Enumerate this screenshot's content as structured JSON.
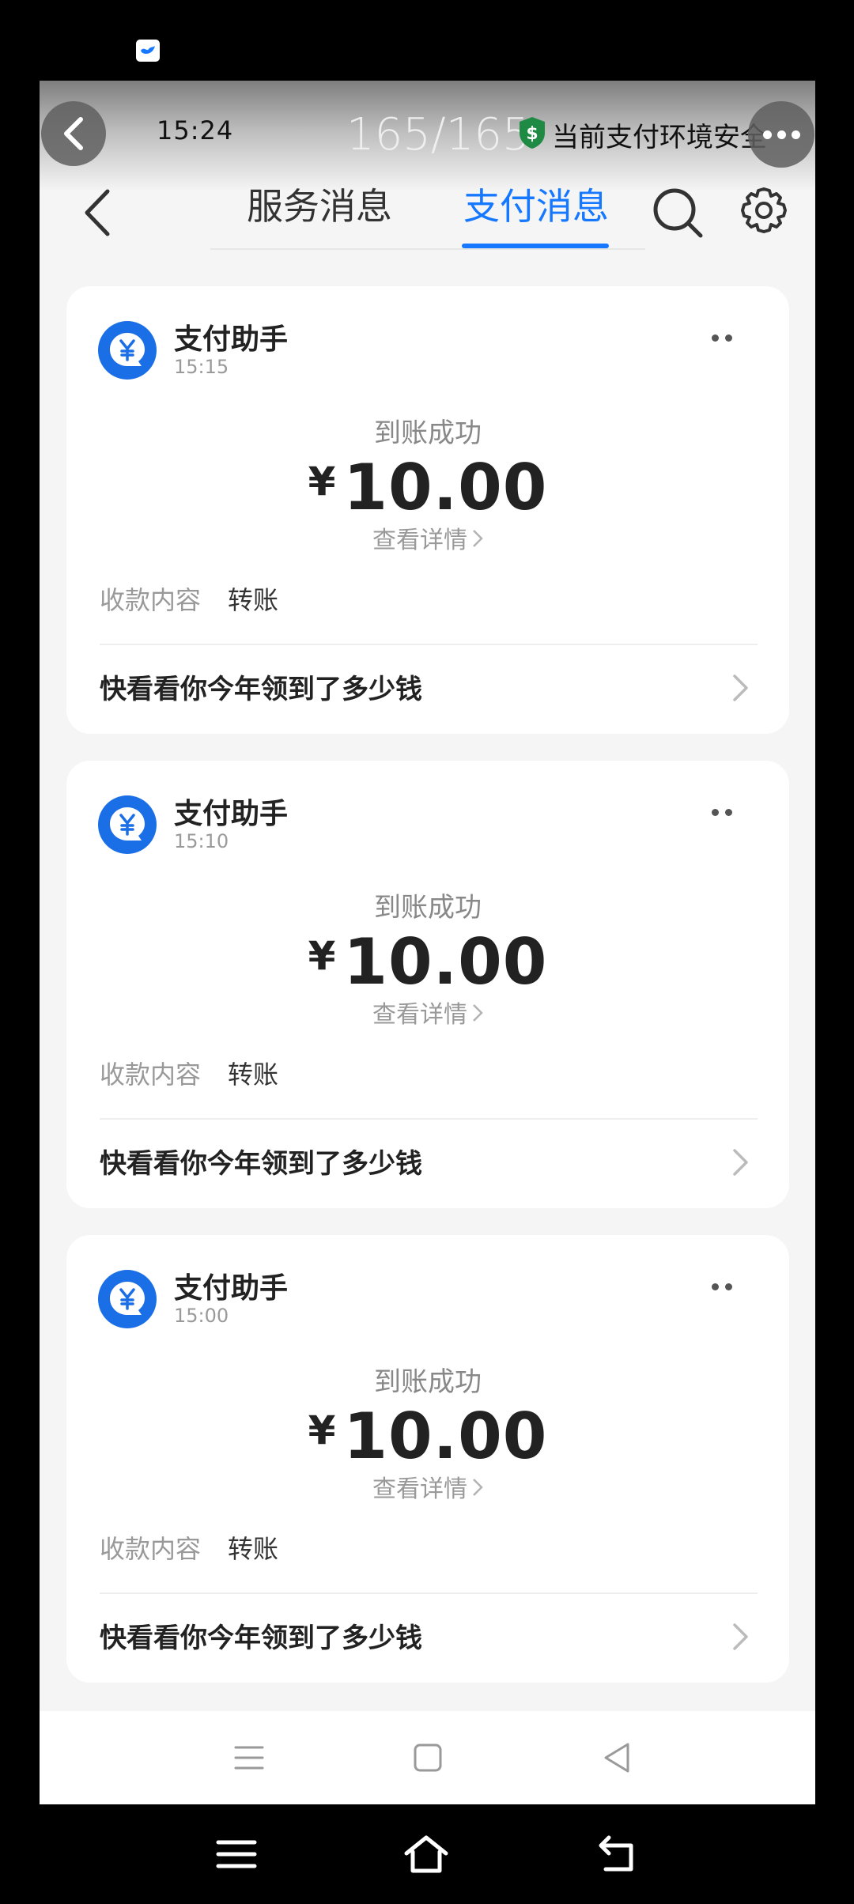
{
  "overlay": {
    "time": "15:24",
    "count": "165/165",
    "safe_text": "当前支付环境安全"
  },
  "nav": {
    "tab_service": "服务消息",
    "tab_pay": "支付消息"
  },
  "colors": {
    "accent": "#1677ff",
    "avatar": "#1a6fe6",
    "shield": "#1f8a43"
  },
  "messages": [
    {
      "sender": "支付助手",
      "time": "15:15",
      "status": "到账成功",
      "currency": "¥",
      "amount": "10.00",
      "detail": "查看详情",
      "content_label": "收款内容",
      "content_value": "转账",
      "promo": "快看看你今年领到了多少钱"
    },
    {
      "sender": "支付助手",
      "time": "15:10",
      "status": "到账成功",
      "currency": "¥",
      "amount": "10.00",
      "detail": "查看详情",
      "content_label": "收款内容",
      "content_value": "转账",
      "promo": "快看看你今年领到了多少钱"
    },
    {
      "sender": "支付助手",
      "time": "15:00",
      "status": "到账成功",
      "currency": "¥",
      "amount": "10.00",
      "detail": "查看详情",
      "content_label": "收款内容",
      "content_value": "转账",
      "promo": "快看看你今年领到了多少钱"
    }
  ],
  "icons": {
    "notification": "bird-notification-icon",
    "overlay_back": "chevron-left-icon",
    "shield": "shield-dollar-icon",
    "overlay_more": "more-dots-icon",
    "nav_back": "chevron-left-icon",
    "search": "search-icon",
    "settings": "gear-icon",
    "avatar": "yuan-chat-icon",
    "card_more": "more-dots-icon",
    "promo_chevron": "chevron-right-icon",
    "app_menu": "menu-lines-icon",
    "app_home": "square-home-icon",
    "app_back": "triangle-back-icon",
    "phone_menu": "menu-lines-icon",
    "phone_home": "house-icon",
    "phone_back": "return-arrow-icon"
  }
}
